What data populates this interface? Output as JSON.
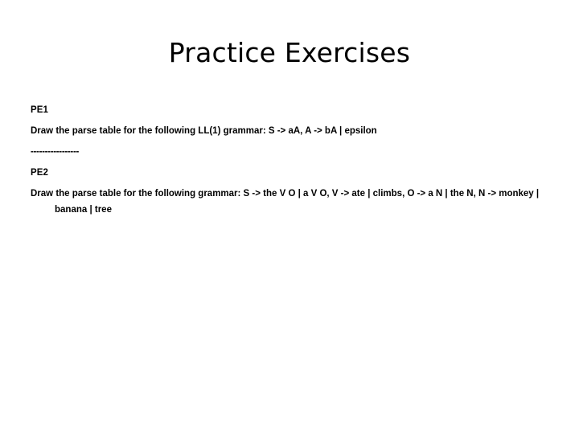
{
  "slide": {
    "title": "Practice Exercises",
    "background_color": "#ffffff",
    "text_color": "#000000",
    "blocks": [
      {
        "id": "pe1-label",
        "text": "PE1"
      },
      {
        "id": "pe1-body",
        "text": "Draw the parse table for the following LL(1) grammar: S -> aA, A -> bA | epsilon"
      },
      {
        "id": "separator",
        "text": "-----------------"
      },
      {
        "id": "pe2-label",
        "text": "PE2"
      },
      {
        "id": "pe2-body",
        "text": "Draw the parse table for the following grammar: S -> the V O | a V O, V -> ate | climbs, O -> a N | the N, N -> monkey | banana | tree"
      }
    ]
  }
}
